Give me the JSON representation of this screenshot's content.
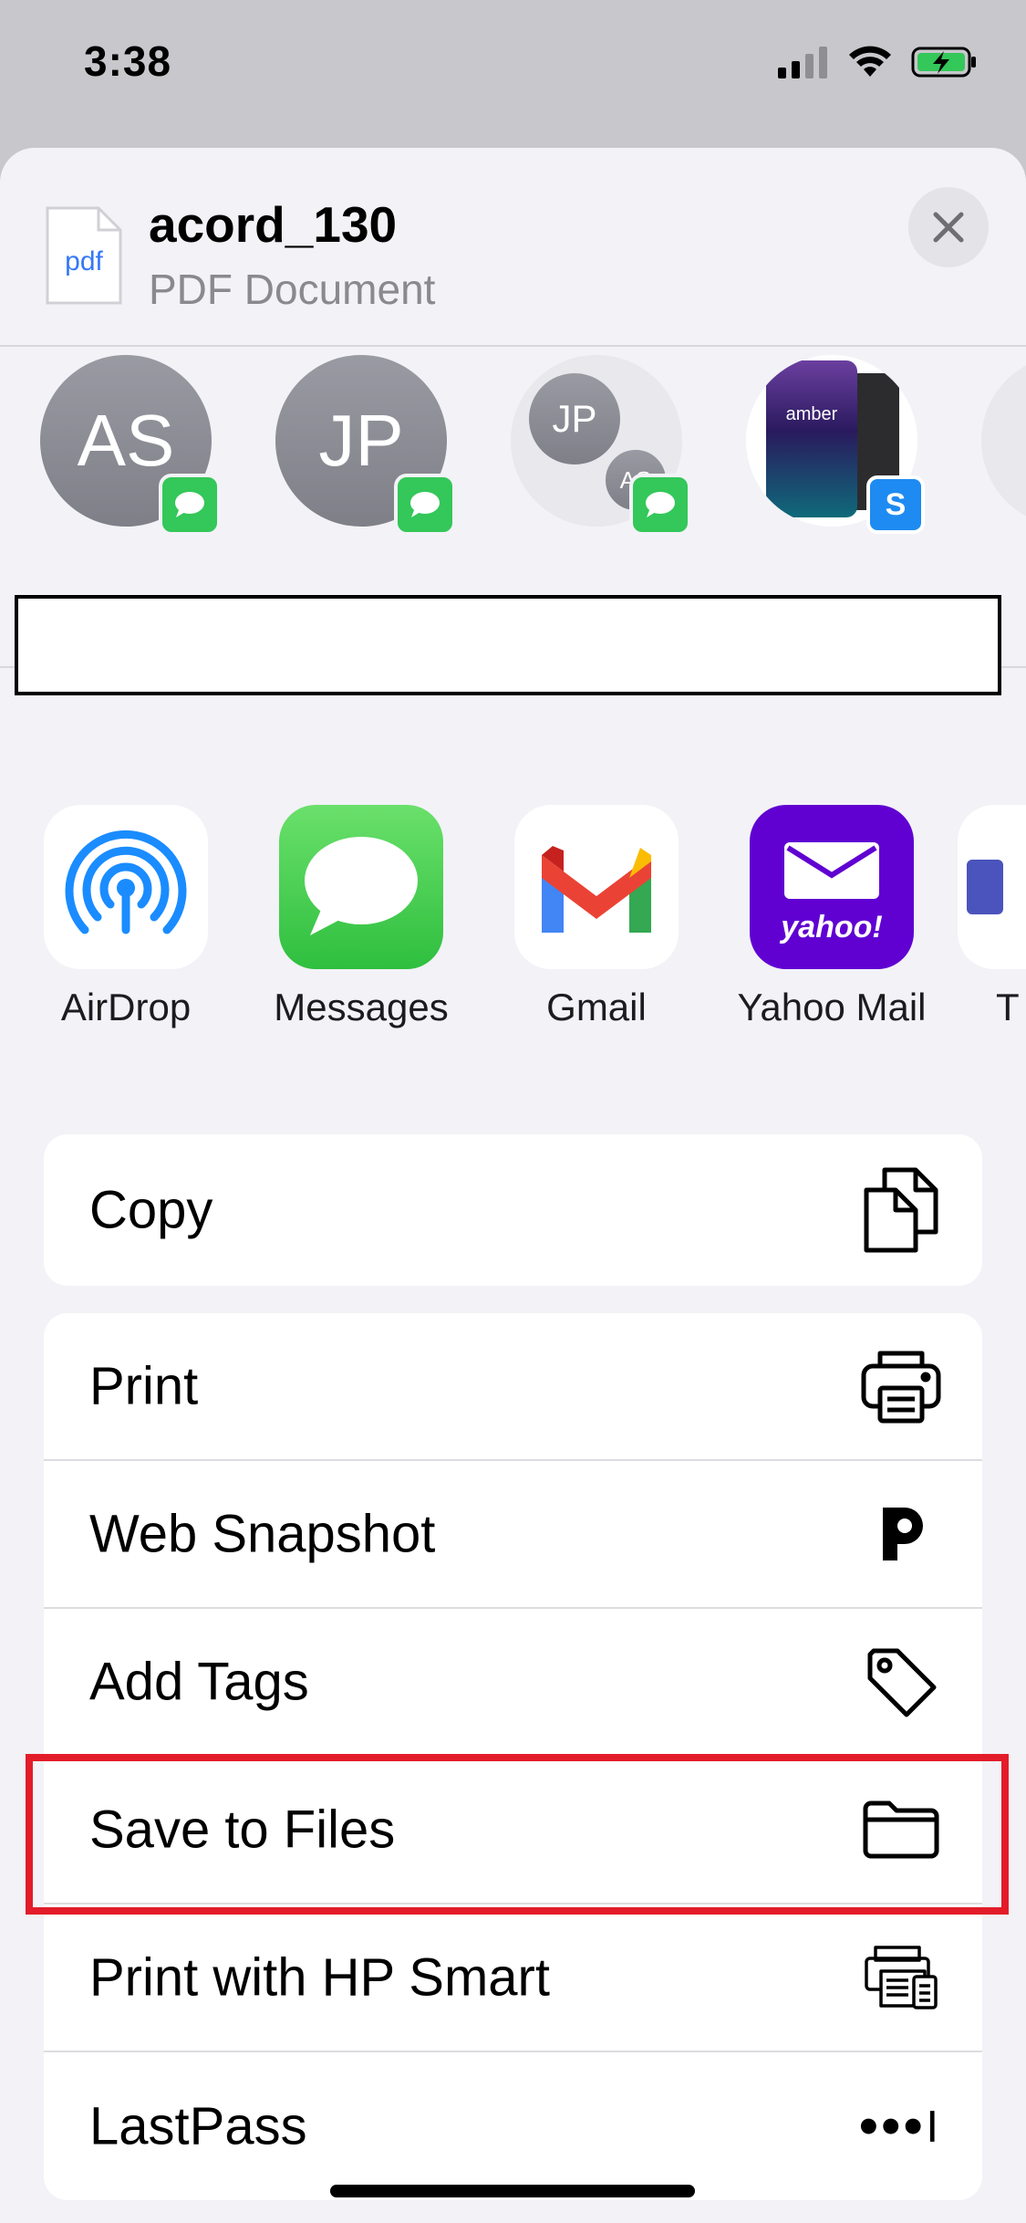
{
  "status_bar": {
    "time": "3:38"
  },
  "header": {
    "file_icon_label": "pdf",
    "title": "acord_130",
    "subtitle": "PDF Document"
  },
  "people": [
    {
      "initials": "AS",
      "badge": "messages-badge"
    },
    {
      "initials": "JP",
      "badge": "messages-badge"
    },
    {
      "initials_a": "JP",
      "initials_b": "AS",
      "badge": "messages-badge"
    },
    {
      "device_text": "amber",
      "badge_text": "S"
    }
  ],
  "apps": [
    {
      "label": "AirDrop",
      "icon": "airdrop-icon"
    },
    {
      "label": "Messages",
      "icon": "messages-icon"
    },
    {
      "label": "Gmail",
      "icon": "gmail-icon"
    },
    {
      "label": "Yahoo Mail",
      "icon": "yahoo-mail-icon",
      "icon_text": "yahoo!"
    },
    {
      "label": "T",
      "icon": "partial-app-icon"
    }
  ],
  "actions_group1": [
    {
      "label": "Copy",
      "icon": "copy-icon"
    }
  ],
  "actions_group2": [
    {
      "label": "Print",
      "icon": "printer-icon"
    },
    {
      "label": "Web Snapshot",
      "icon": "web-snapshot-icon"
    },
    {
      "label": "Add Tags",
      "icon": "tag-icon"
    },
    {
      "label": "Save to Files",
      "icon": "folder-icon"
    },
    {
      "label": "Print with HP Smart",
      "icon": "hp-smart-icon"
    },
    {
      "label": "LastPass",
      "icon": "lastpass-icon"
    }
  ],
  "colors": {
    "highlight": "#e31c2a",
    "messages_green": "#34c759",
    "yahoo_purple": "#6001d2",
    "airdrop_blue": "#1a8cff"
  }
}
